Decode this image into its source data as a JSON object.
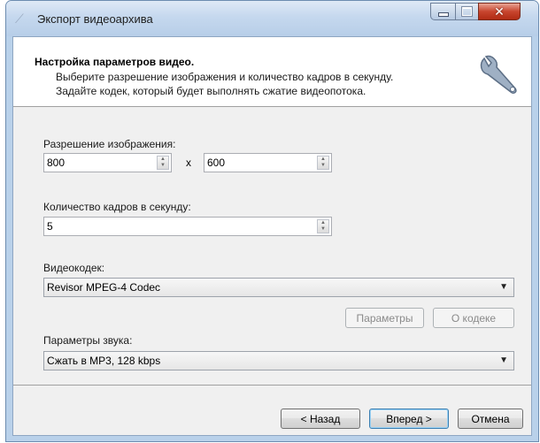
{
  "window": {
    "title": "Экспорт видеоархива",
    "controls": {
      "minimize": "minimize",
      "maximize": "maximize",
      "close": "✕"
    }
  },
  "header": {
    "title": "Настройка параметров видео.",
    "line1": "Выберите разрешение изображения и количество кадров в секунду.",
    "line2": "Задайте кодек, который будет выполнять сжатие видеопотока."
  },
  "resolution": {
    "label": "Разрешение изображения:",
    "width": "800",
    "separator": "x",
    "height": "600"
  },
  "fps": {
    "label": "Количество кадров в секунду:",
    "value": "5"
  },
  "codec": {
    "label": "Видеокодек:",
    "selected": "Revisor MPEG-4 Codec",
    "params_button": "Параметры",
    "about_button": "О кодеке"
  },
  "audio": {
    "label": "Параметры звука:",
    "selected": "Сжать в MP3, 128 kbps"
  },
  "footer": {
    "back_button": "< Назад",
    "next_button": "Вперед >",
    "cancel_button": "Отмена"
  },
  "icons": {
    "header_icon": "wrench-icon",
    "spin": "spin-updown-icon",
    "dropdown": "chevron-down-icon"
  }
}
